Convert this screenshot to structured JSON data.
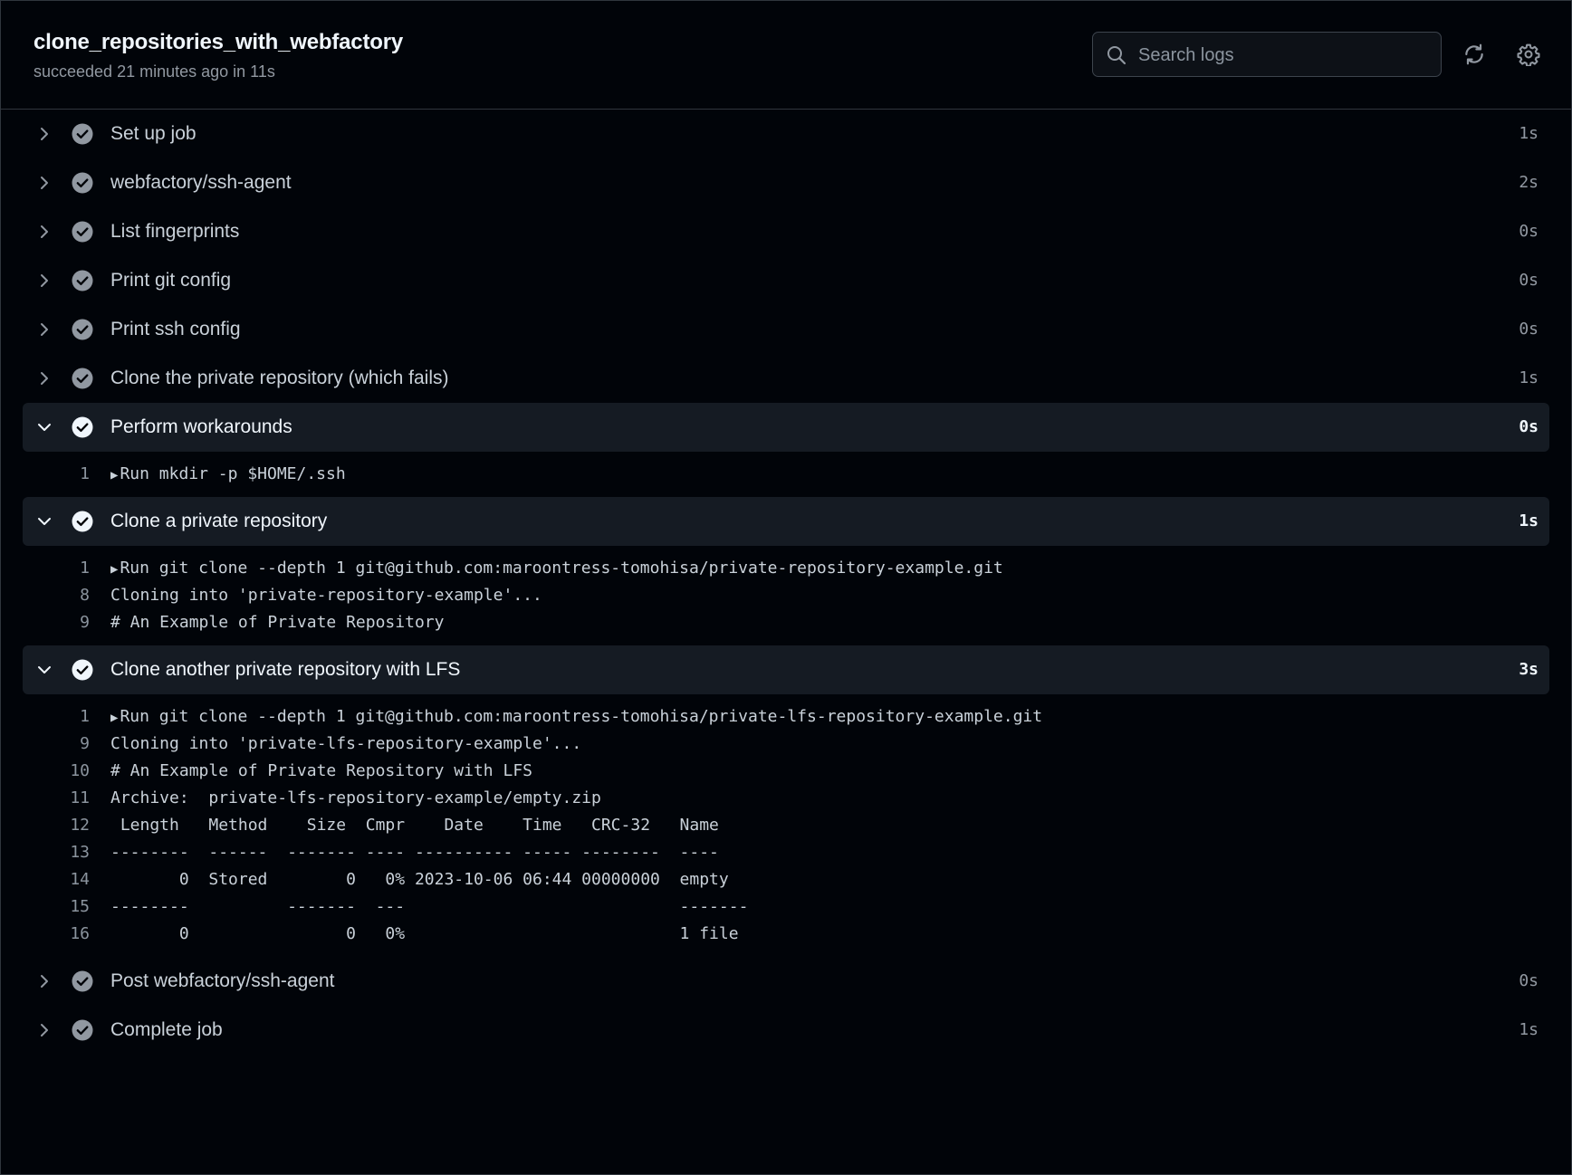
{
  "job": {
    "title": "clone_repositories_with_webfactory",
    "status": "succeeded 21 minutes ago in 11s"
  },
  "search": {
    "placeholder": "Search logs"
  },
  "icons": {
    "search": "search-icon",
    "refresh": "sync-icon",
    "settings": "gear-icon",
    "collapsed": "chevron-right-icon",
    "expanded": "chevron-down-icon",
    "success": "check-circle-icon"
  },
  "colors": {
    "background": "#010409",
    "expanded_row": "#151b23",
    "check_grey": "#9198a1",
    "check_white": "#f0f6fc"
  },
  "steps": [
    {
      "label": "Set up job",
      "duration": "1s"
    },
    {
      "label": "webfactory/ssh-agent",
      "duration": "2s"
    },
    {
      "label": "List fingerprints",
      "duration": "0s"
    },
    {
      "label": "Print git config",
      "duration": "0s"
    },
    {
      "label": "Print ssh config",
      "duration": "0s"
    },
    {
      "label": "Clone the private repository (which fails)",
      "duration": "1s"
    },
    {
      "label": "Perform workarounds",
      "duration": "0s",
      "expanded": true,
      "log": [
        {
          "n": "1",
          "text": "Run mkdir -p $HOME/.ssh",
          "group": true
        }
      ]
    },
    {
      "label": "Clone a private repository",
      "duration": "1s",
      "expanded": true,
      "log": [
        {
          "n": "1",
          "text": "Run git clone --depth 1 git@github.com:maroontress-tomohisa/private-repository-example.git",
          "group": true
        },
        {
          "n": "8",
          "text": "Cloning into 'private-repository-example'..."
        },
        {
          "n": "9",
          "text": "# An Example of Private Repository"
        }
      ]
    },
    {
      "label": "Clone another private repository with LFS",
      "duration": "3s",
      "expanded": true,
      "log": [
        {
          "n": "1",
          "text": "Run git clone --depth 1 git@github.com:maroontress-tomohisa/private-lfs-repository-example.git",
          "group": true
        },
        {
          "n": "9",
          "text": "Cloning into 'private-lfs-repository-example'..."
        },
        {
          "n": "10",
          "text": "# An Example of Private Repository with LFS"
        },
        {
          "n": "11",
          "text": "Archive:  private-lfs-repository-example/empty.zip"
        },
        {
          "n": "12",
          "text": " Length   Method    Size  Cmpr    Date    Time   CRC-32   Name"
        },
        {
          "n": "13",
          "text": "--------  ------  ------- ---- ---------- ----- --------  ----"
        },
        {
          "n": "14",
          "text": "       0  Stored        0   0% 2023-10-06 06:44 00000000  empty"
        },
        {
          "n": "15",
          "text": "--------          -------  ---                            -------"
        },
        {
          "n": "16",
          "text": "       0                0   0%                            1 file"
        }
      ]
    },
    {
      "label": "Post webfactory/ssh-agent",
      "duration": "0s"
    },
    {
      "label": "Complete job",
      "duration": "1s"
    }
  ]
}
